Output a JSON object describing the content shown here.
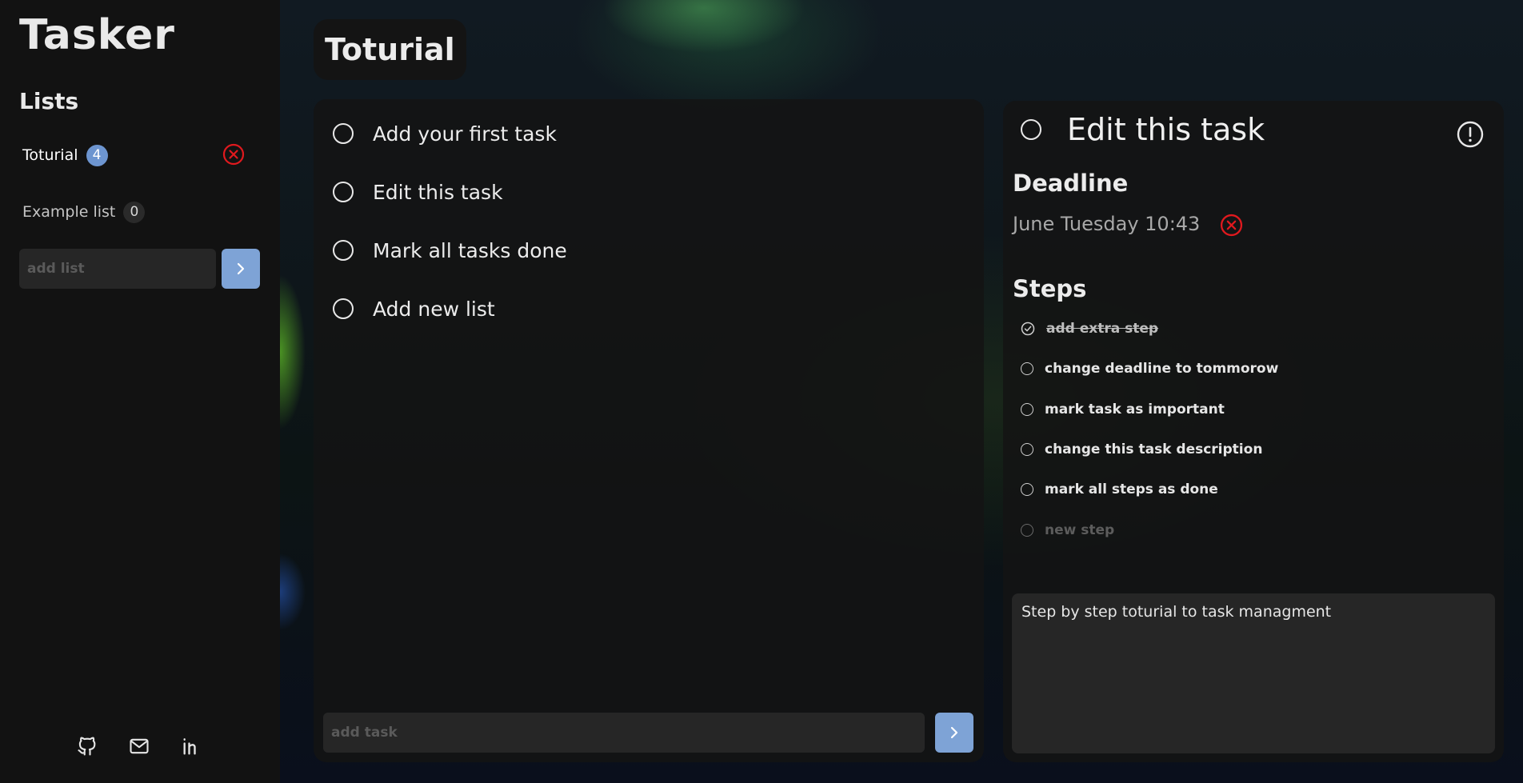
{
  "app": {
    "title": "Tasker"
  },
  "sidebar": {
    "lists_heading": "Lists",
    "lists": [
      {
        "name": "Toturial",
        "count": "4",
        "active": true
      },
      {
        "name": "Example list",
        "count": "0",
        "active": false
      }
    ],
    "add_list_placeholder": "add list",
    "social_icons": [
      "github-icon",
      "mail-icon",
      "linkedin-icon"
    ]
  },
  "main": {
    "list_title": "Toturial",
    "tasks": [
      {
        "label": "Add your first task",
        "done": false
      },
      {
        "label": "Edit this task",
        "done": false
      },
      {
        "label": "Mark all tasks done",
        "done": false
      },
      {
        "label": "Add new list",
        "done": false
      }
    ],
    "add_task_placeholder": "add task"
  },
  "detail": {
    "task_title": "Edit this task",
    "deadline_heading": "Deadline",
    "deadline_value": "June Tuesday 10:43",
    "steps_heading": "Steps",
    "steps": [
      {
        "label": "add extra step",
        "done": true
      },
      {
        "label": "change deadline to tommorow",
        "done": false
      },
      {
        "label": "mark task as important",
        "done": false
      },
      {
        "label": "change this task description",
        "done": false
      },
      {
        "label": "mark all steps as done",
        "done": false
      }
    ],
    "new_step_placeholder": "new step",
    "description": "Step by step toturial to task managment"
  },
  "colors": {
    "accent": "#7ea3d6",
    "badge": "#6d95d0",
    "danger": "#e0191e",
    "sidebar_bg": "#121212",
    "panel_bg": "#141414",
    "input_bg": "#262626"
  }
}
